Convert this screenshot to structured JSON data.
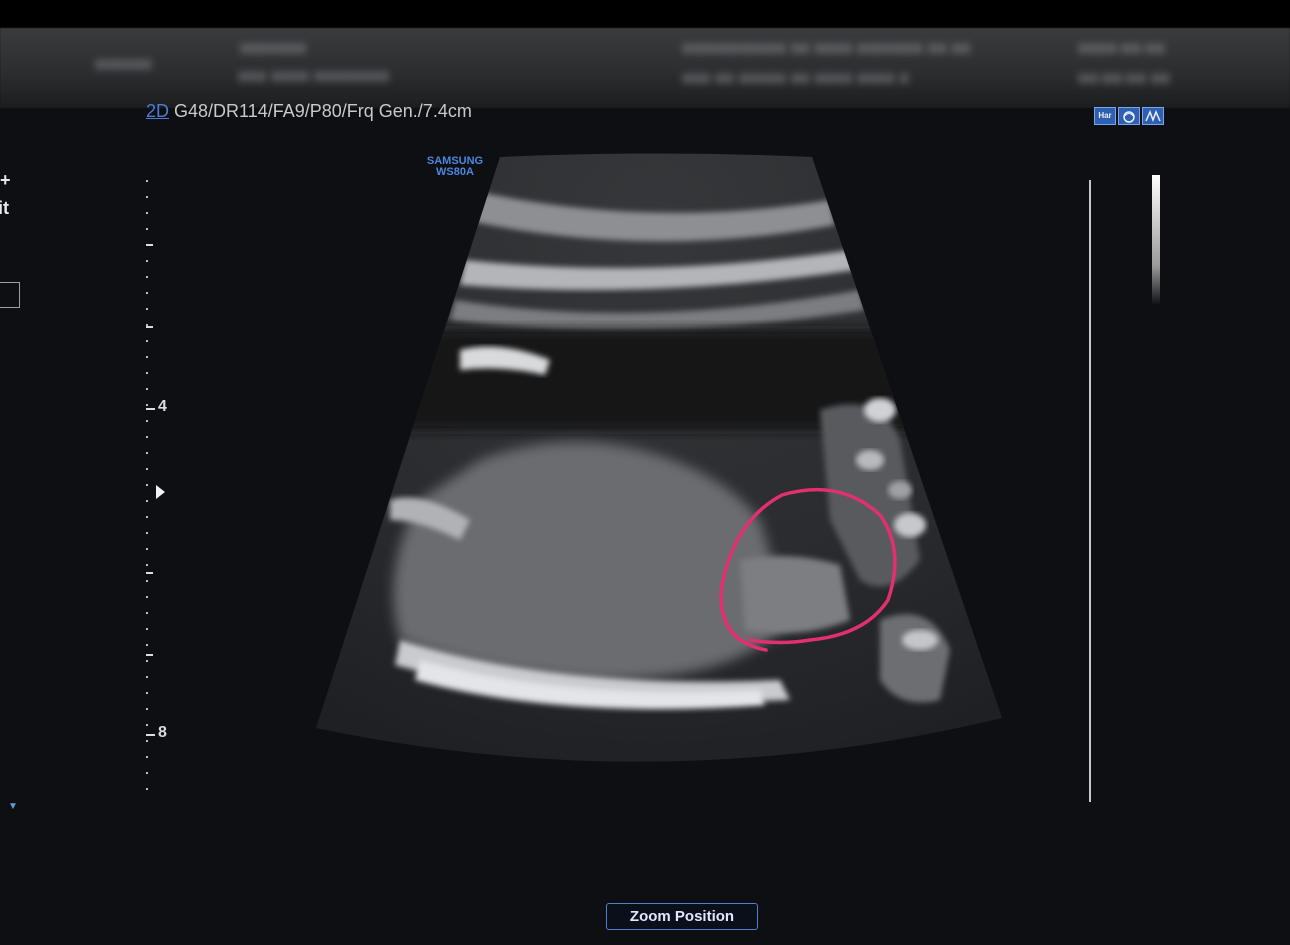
{
  "scan_params": {
    "mode": "2D",
    "settings": " G48/DR114/FA9/P80/Frq Gen./7.4cm"
  },
  "brand": {
    "line1": "SAMSUNG",
    "line2": "WS80A"
  },
  "mode_icons": [
    "Har",
    "probe-icon",
    "harmonic-icon"
  ],
  "left_panel": {
    "symbol": "+",
    "fragment": "it"
  },
  "depth_scale": {
    "labels": [
      "4",
      "8"
    ]
  },
  "buttons": {
    "zoom_position": "Zoom Position"
  },
  "colors": {
    "accent": "#4f7fd0",
    "annotation": "#e2306f",
    "background": "#0d0f12"
  }
}
